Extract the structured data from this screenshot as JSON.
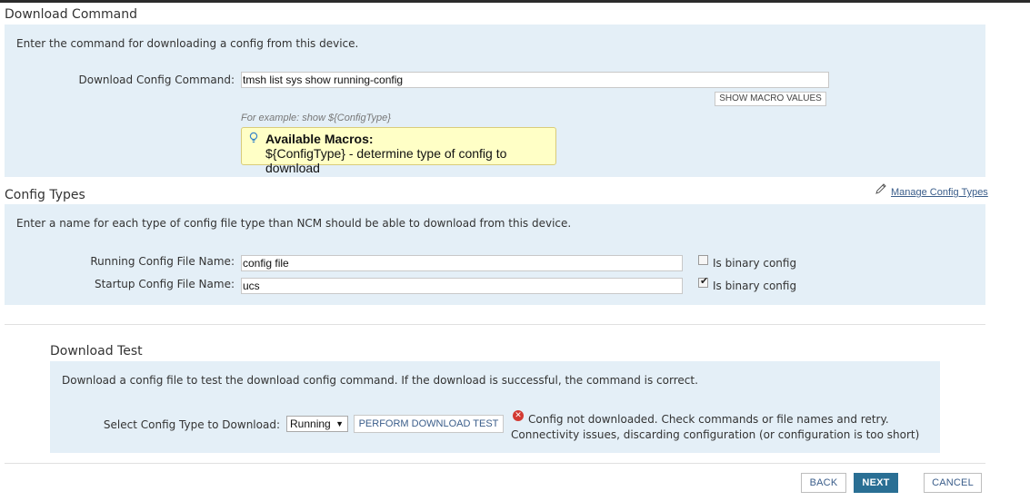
{
  "download_command": {
    "title": "Download Command",
    "description": "Enter the command for downloading a config from this device.",
    "command_label": "Download Config Command:",
    "command_value": "tmsh list sys show running-config",
    "show_macro_values_label": "SHOW MACRO VALUES",
    "example_text": "For example: show ${ConfigType}",
    "macros": {
      "heading": "Available Macros:",
      "items": [
        "${ConfigType} - determine type of config to download"
      ]
    }
  },
  "config_types": {
    "title": "Config Types",
    "manage_link": "Manage Config Types",
    "description": "Enter a name for each type of config file type than NCM should be able to download from this device.",
    "rows": [
      {
        "label": "Running Config File Name:",
        "value": "config file",
        "binary_label": "Is binary config",
        "binary_checked": false
      },
      {
        "label": "Startup Config File Name:",
        "value": "ucs",
        "binary_label": "Is binary config",
        "binary_checked": true
      }
    ]
  },
  "download_test": {
    "title": "Download Test",
    "description": "Download a config file to test the download config command. If the download is successful, the command is correct.",
    "select_label": "Select Config Type to Download:",
    "selected_type": "Running",
    "perform_button": "PERFORM DOWNLOAD TEST",
    "error_line1": "Config not downloaded. Check commands or file names and retry.",
    "error_line2": "Connectivity issues, discarding configuration (or configuration is too short)"
  },
  "footer": {
    "back_label": "BACK",
    "next_label": "NEXT",
    "cancel_label": "CANCEL"
  },
  "colors": {
    "panel_bg": "#e4eff7",
    "primary_button": "#2a6f94",
    "macro_box_bg": "#ffffc6",
    "error_icon": "#d33a32",
    "link": "#3a5d8a"
  }
}
